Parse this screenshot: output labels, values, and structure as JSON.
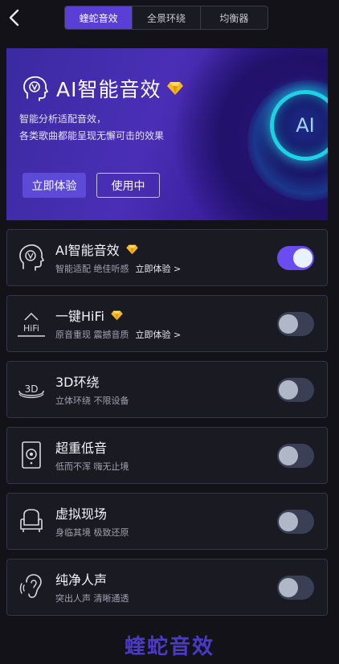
{
  "tabs": [
    {
      "label": "蝰蛇音效",
      "active": true
    },
    {
      "label": "全景环绕",
      "active": false
    },
    {
      "label": "均衡器",
      "active": false
    }
  ],
  "banner": {
    "title": "AI智能音效",
    "desc_line1": "智能分析适配音效，",
    "desc_line2": "各类歌曲都能呈现无懈可击的效果",
    "badge_text": "AI",
    "try_button": "立即体验",
    "in_use_button": "使用中"
  },
  "settings": [
    {
      "title": "AI智能音效",
      "subtitle": "智能适配 绝佳听感",
      "link": "立即体验 >",
      "premium": true,
      "enabled": true,
      "icon": "ai-head-icon"
    },
    {
      "title": "一键HiFi",
      "subtitle": "原音重现 震撼音质",
      "link": "立即体验 >",
      "premium": true,
      "enabled": false,
      "icon": "hifi-icon",
      "icon_text": "HiFi"
    },
    {
      "title": "3D环绕",
      "subtitle": "立体环绕 不限设备",
      "premium": false,
      "enabled": false,
      "icon": "3d-surround-icon",
      "icon_text": "3D"
    },
    {
      "title": "超重低音",
      "subtitle": "低而不浑 嗨无止境",
      "premium": false,
      "enabled": false,
      "icon": "speaker-icon"
    },
    {
      "title": "虚拟现场",
      "subtitle": "身临其境 极致还原",
      "premium": false,
      "enabled": false,
      "icon": "armchair-icon"
    },
    {
      "title": "纯净人声",
      "subtitle": "突出人声 清晰通透",
      "premium": false,
      "enabled": false,
      "icon": "ear-icon"
    }
  ],
  "footer": {
    "logo_text": "蝰蛇音效"
  },
  "colors": {
    "accent": "#5a3fd6",
    "toggle_on": "#6a4cf0",
    "gem": "#f5b922",
    "ring": "#1ed2e6"
  }
}
